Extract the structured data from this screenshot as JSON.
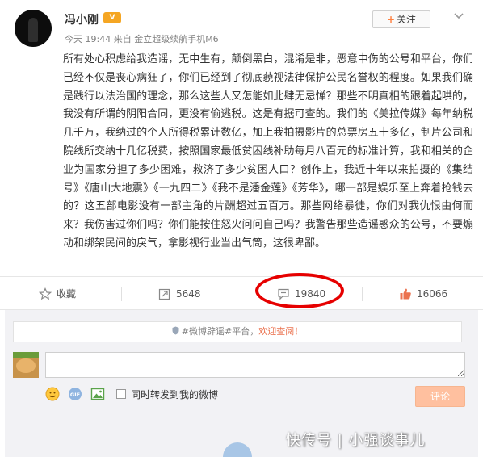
{
  "post": {
    "username": "冯小刚",
    "vip_badge": "V",
    "meta": "今天 19:44 来自 金立超级续航手机M6",
    "follow_plus": "+",
    "follow_label": "关注",
    "content": "所有处心积虑给我造谣，无中生有，颠倒黑白，混淆是非，恶意中伤的公号和平台，你们已经不仅是丧心病狂了，你们已经到了彻底藐视法律保护公民名誉权的程度。如果我们确是践行以法治国的理念，那么这些人又怎能如此肆无忌惮？那些不明真相的跟着起哄的，我没有所谓的阴阳合同，更没有偷逃税。这是有据可查的。我们的《美拉传媒》每年纳税几千万，我纳过的个人所得税累计数亿，加上我拍摄影片的总票房五十多亿，制片公司和院线所交纳十几亿税费，按照国家最低贫困线补助每月八百元的标准计算，我和相关的企业为国家分担了多少困难，救济了多少贫困人口？创作上，我近十年以来拍摄的《集结号》《唐山大地震》《一九四二》《我不是潘金莲》《芳华》，哪一部是娱乐至上奔着抢钱去的？这五部电影没有一部主角的片酬超过五百万。那些网络暴徒，你们对我仇恨由何而来？我伤害过你们吗？你们能按住怒火问问自己吗？我警告那些造谣惑众的公号，不要煽动和绑架民间的戾气，拿影视行业当出气筒，这很卑鄙。"
  },
  "actions": {
    "favorite_label": "收藏",
    "repost_count": "5648",
    "comment_count": "19840",
    "like_count": "16066"
  },
  "reply": {
    "notice_prefix": "#微博辟谣#平台，",
    "notice_highlight": "欢迎查阅！",
    "input_placeholder": "",
    "repost_label": "同时转发到我的微博",
    "submit_label": "评论"
  },
  "watermark": "快传号 | 小强谈事儿",
  "colors": {
    "accent_orange": "#eb7350",
    "circle_annotation": "#e60000",
    "submit_disabled": "#ffc09f"
  }
}
